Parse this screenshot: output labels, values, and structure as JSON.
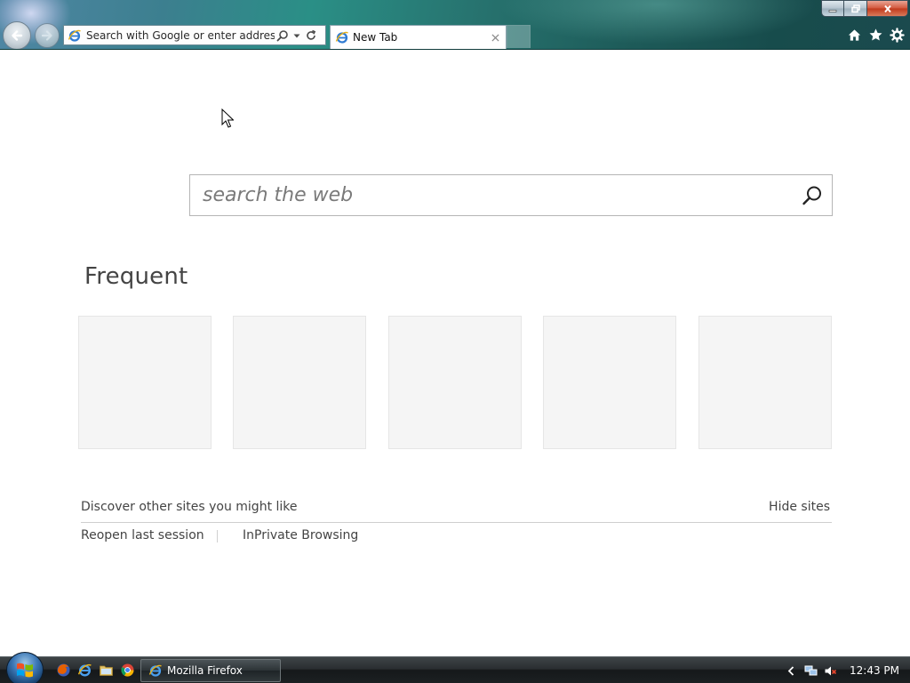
{
  "browser": {
    "address_placeholder": "Search with Google or enter address",
    "tab_label": "New Tab",
    "icons": {
      "back": "back-arrow-icon",
      "forward": "forward-arrow-icon",
      "search": "search-icon",
      "dropdown": "chevron-down-icon",
      "refresh": "refresh-icon",
      "close_tab": "close-icon",
      "home": "home-icon",
      "favorites": "star-icon",
      "tools": "gear-icon"
    }
  },
  "page": {
    "search_placeholder": "search the web",
    "frequent_heading": "Frequent",
    "tiles": [
      {},
      {},
      {},
      {},
      {}
    ],
    "discover_label": "Discover other sites you might like",
    "hide_sites_label": "Hide sites",
    "reopen_label": "Reopen last session",
    "inprivate_label": "InPrivate Browsing"
  },
  "taskbar": {
    "task_label": "Mozilla Firefox",
    "clock": "12:43 PM",
    "quick_launch": [
      "firefox-icon",
      "internet-explorer-icon",
      "folder-icon",
      "chrome-icon"
    ],
    "tray": [
      "chevron-left-icon",
      "network-icon",
      "volume-muted-icon"
    ]
  },
  "colors": {
    "titlebar_accent": "#2a8f86",
    "close_button": "#c0391c",
    "tile_background": "#f5f5f5",
    "text_gray": "#444444"
  }
}
